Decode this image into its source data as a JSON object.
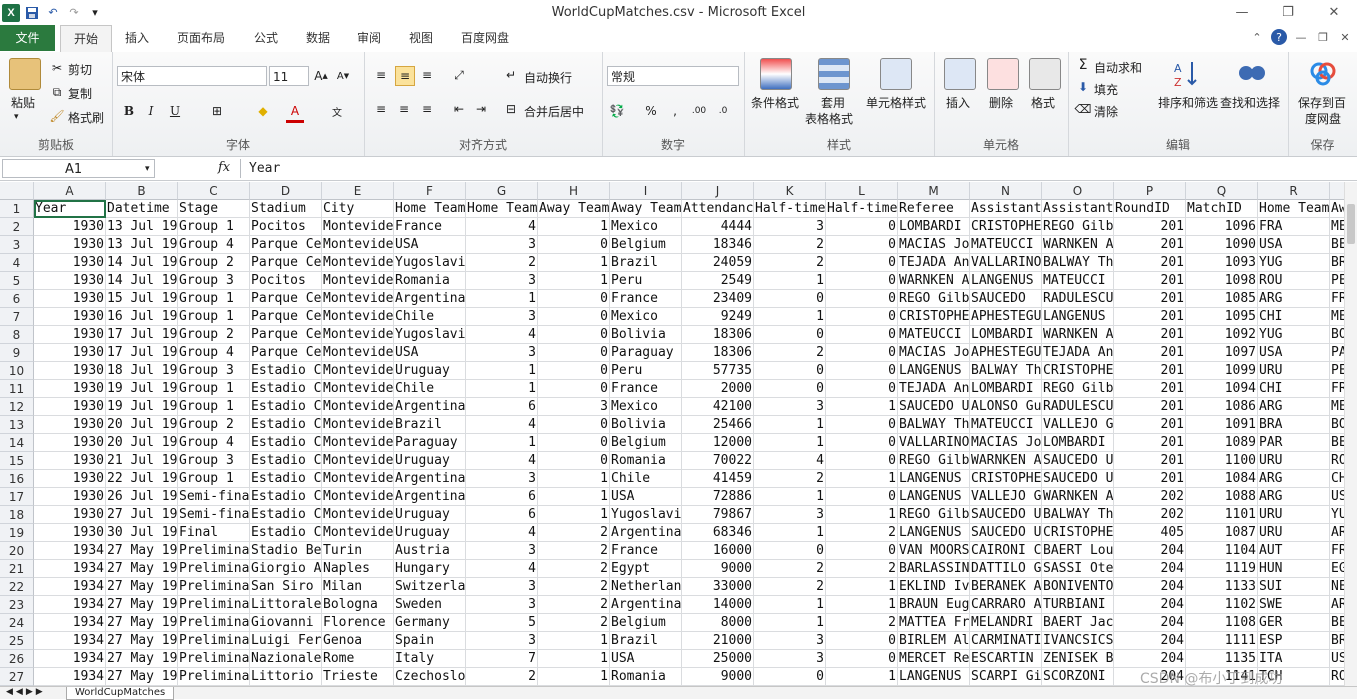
{
  "window": {
    "title": "WorldCupMatches.csv - Microsoft Excel"
  },
  "tabs": [
    {
      "label": "文件"
    },
    {
      "label": "开始"
    },
    {
      "label": "插入"
    },
    {
      "label": "页面布局"
    },
    {
      "label": "公式"
    },
    {
      "label": "数据"
    },
    {
      "label": "审阅"
    },
    {
      "label": "视图"
    },
    {
      "label": "百度网盘"
    }
  ],
  "ribbon": {
    "clipboard": {
      "label": "剪贴板",
      "paste": "粘贴",
      "cut": "剪切",
      "copy": "复制",
      "format_painter": "格式刷"
    },
    "font": {
      "label": "字体",
      "name": "宋体",
      "size": "11"
    },
    "alignment": {
      "label": "对齐方式",
      "wrap": "自动换行",
      "merge": "合并后居中"
    },
    "number": {
      "label": "数字",
      "format": "常规"
    },
    "styles": {
      "label": "样式",
      "cond": "条件格式",
      "table1": "套用",
      "table2": "表格格式",
      "cell_styles": "单元格样式"
    },
    "cells": {
      "label": "单元格",
      "insert": "插入",
      "delete": "删除",
      "format": "格式"
    },
    "editing": {
      "label": "编辑",
      "autosum": "自动求和",
      "fill": "填充",
      "clear": "清除",
      "sort": "排序和筛选",
      "find": "查找和选择"
    },
    "save": {
      "label": "保存",
      "line1": "保存到百",
      "line2": "度网盘"
    }
  },
  "formula_bar": {
    "namebox": "A1",
    "fx": "fx",
    "content": "Year"
  },
  "columns": [
    "A",
    "B",
    "C",
    "D",
    "E",
    "F",
    "G",
    "H",
    "I",
    "J",
    "K",
    "L",
    "M",
    "N",
    "O",
    "P",
    "Q",
    "R",
    "S"
  ],
  "rows": [
    [
      "Year",
      "Datetime",
      "Stage",
      "Stadium",
      "City",
      "Home Team",
      "Home Team",
      "Away Team",
      "Away Team",
      "Attendance",
      "Half-time",
      "Half-time",
      "Referee",
      "Assistant",
      "Assistant",
      "RoundID",
      "MatchID",
      "Home Team",
      "Aw"
    ],
    [
      "1930",
      "13 Jul 19",
      "Group 1",
      "Pocitos",
      "Montevideo",
      "France",
      "4",
      "1",
      "Mexico",
      "4444",
      "3",
      "0",
      "LOMBARDI",
      "CRISTOPHE",
      "REGO Gilb",
      "201",
      "1096",
      "FRA",
      "ME"
    ],
    [
      "1930",
      "13 Jul 19",
      "Group 4",
      "Parque Ce",
      "Montevideo",
      "USA",
      "3",
      "0",
      "Belgium",
      "18346",
      "2",
      "0",
      "MACIAS Jo",
      "MATEUCCI",
      "WARNKEN A",
      "201",
      "1090",
      "USA",
      "BE"
    ],
    [
      "1930",
      "14 Jul 19",
      "Group 2",
      "Parque Ce",
      "Montevideo",
      "Yugoslavia",
      "2",
      "1",
      "Brazil",
      "24059",
      "2",
      "0",
      "TEJADA An",
      "VALLARINO",
      "BALWAY Th",
      "201",
      "1093",
      "YUG",
      "BR"
    ],
    [
      "1930",
      "14 Jul 19",
      "Group 3",
      "Pocitos",
      "Montevideo",
      "Romania",
      "3",
      "1",
      "Peru",
      "2549",
      "1",
      "0",
      "WARNKEN A",
      "LANGENUS",
      "MATEUCCI",
      "201",
      "1098",
      "ROU",
      "PE"
    ],
    [
      "1930",
      "15 Jul 19",
      "Group 1",
      "Parque Ce",
      "Montevideo",
      "Argentina",
      "1",
      "0",
      "France",
      "23409",
      "0",
      "0",
      "REGO Gilb",
      "SAUCEDO",
      "RADULESCU",
      "201",
      "1085",
      "ARG",
      "FR"
    ],
    [
      "1930",
      "16 Jul 19",
      "Group 1",
      "Parque Ce",
      "Montevideo",
      "Chile",
      "3",
      "0",
      "Mexico",
      "9249",
      "1",
      "0",
      "CRISTOPHE",
      "APHESTEGU",
      "LANGENUS",
      "201",
      "1095",
      "CHI",
      "ME"
    ],
    [
      "1930",
      "17 Jul 19",
      "Group 2",
      "Parque Ce",
      "Montevideo",
      "Yugoslavia",
      "4",
      "0",
      "Bolivia",
      "18306",
      "0",
      "0",
      "MATEUCCI",
      "LOMBARDI",
      "WARNKEN A",
      "201",
      "1092",
      "YUG",
      "BO"
    ],
    [
      "1930",
      "17 Jul 19",
      "Group 4",
      "Parque Ce",
      "Montevideo",
      "USA",
      "3",
      "0",
      "Paraguay",
      "18306",
      "2",
      "0",
      "MACIAS Jo",
      "APHESTEGU",
      "TEJADA An",
      "201",
      "1097",
      "USA",
      "PA"
    ],
    [
      "1930",
      "18 Jul 19",
      "Group 3",
      "Estadio C",
      "Montevideo",
      "Uruguay",
      "1",
      "0",
      "Peru",
      "57735",
      "0",
      "0",
      "LANGENUS",
      "BALWAY Th",
      "CRISTOPHE",
      "201",
      "1099",
      "URU",
      "PE"
    ],
    [
      "1930",
      "19 Jul 19",
      "Group 1",
      "Estadio C",
      "Montevideo",
      "Chile",
      "1",
      "0",
      "France",
      "2000",
      "0",
      "0",
      "TEJADA An",
      "LOMBARDI",
      "REGO Gilb",
      "201",
      "1094",
      "CHI",
      "FR"
    ],
    [
      "1930",
      "19 Jul 19",
      "Group 1",
      "Estadio C",
      "Montevideo",
      "Argentina",
      "6",
      "3",
      "Mexico",
      "42100",
      "3",
      "1",
      "SAUCEDO U",
      "ALONSO Gu",
      "RADULESCU",
      "201",
      "1086",
      "ARG",
      "ME"
    ],
    [
      "1930",
      "20 Jul 19",
      "Group 2",
      "Estadio C",
      "Montevideo",
      "Brazil",
      "4",
      "0",
      "Bolivia",
      "25466",
      "1",
      "0",
      "BALWAY Th",
      "MATEUCCI",
      "VALLEJO G",
      "201",
      "1091",
      "BRA",
      "BO"
    ],
    [
      "1930",
      "20 Jul 19",
      "Group 4",
      "Estadio C",
      "Montevideo",
      "Paraguay",
      "1",
      "0",
      "Belgium",
      "12000",
      "1",
      "0",
      "VALLARINO",
      "MACIAS Jo",
      "LOMBARDI",
      "201",
      "1089",
      "PAR",
      "BE"
    ],
    [
      "1930",
      "21 Jul 19",
      "Group 3",
      "Estadio C",
      "Montevideo",
      "Uruguay",
      "4",
      "0",
      "Romania",
      "70022",
      "4",
      "0",
      "REGO Gilb",
      "WARNKEN A",
      "SAUCEDO U",
      "201",
      "1100",
      "URU",
      "RO"
    ],
    [
      "1930",
      "22 Jul 19",
      "Group 1",
      "Estadio C",
      "Montevideo",
      "Argentina",
      "3",
      "1",
      "Chile",
      "41459",
      "2",
      "1",
      "LANGENUS",
      "CRISTOPHE",
      "SAUCEDO U",
      "201",
      "1084",
      "ARG",
      "CH"
    ],
    [
      "1930",
      "26 Jul 19",
      "Semi-fina",
      "Estadio C",
      "Montevideo",
      "Argentina",
      "6",
      "1",
      "USA",
      "72886",
      "1",
      "0",
      "LANGENUS",
      "VALLEJO G",
      "WARNKEN A",
      "202",
      "1088",
      "ARG",
      "US"
    ],
    [
      "1930",
      "27 Jul 19",
      "Semi-fina",
      "Estadio C",
      "Montevideo",
      "Uruguay",
      "6",
      "1",
      "Yugoslavia",
      "79867",
      "3",
      "1",
      "REGO Gilb",
      "SAUCEDO U",
      "BALWAY Th",
      "202",
      "1101",
      "URU",
      "YU"
    ],
    [
      "1930",
      "30 Jul 19",
      "Final",
      "Estadio C",
      "Montevideo",
      "Uruguay",
      "4",
      "2",
      "Argentina",
      "68346",
      "1",
      "2",
      "LANGENUS",
      "SAUCEDO U",
      "CRISTOPHE",
      "405",
      "1087",
      "URU",
      "AR"
    ],
    [
      "1934",
      "27 May 19",
      "Prelimina",
      "Stadio Be",
      "Turin",
      "Austria",
      "3",
      "2",
      "France",
      "16000",
      "0",
      "0",
      "VAN MOORS",
      "CAIRONI C",
      "BAERT Lou",
      "204",
      "1104",
      "AUT",
      "FR"
    ],
    [
      "1934",
      "27 May 19",
      "Prelimina",
      "Giorgio A",
      "Naples",
      "Hungary",
      "4",
      "2",
      "Egypt",
      "9000",
      "2",
      "2",
      "BARLASSIN",
      "DATTILO G",
      "SASSI Ote",
      "204",
      "1119",
      "HUN",
      "EG"
    ],
    [
      "1934",
      "27 May 19",
      "Prelimina",
      "San Siro",
      "Milan",
      "Switzerland",
      "3",
      "2",
      "Netherlands",
      "33000",
      "2",
      "1",
      "EKLIND Iv",
      "BERANEK A",
      "BONIVENTO",
      "204",
      "1133",
      "SUI",
      "NE"
    ],
    [
      "1934",
      "27 May 19",
      "Prelimina",
      "Littorale",
      "Bologna",
      "Sweden",
      "3",
      "2",
      "Argentina",
      "14000",
      "1",
      "1",
      "BRAUN Eug",
      "CARRARO A",
      "TURBIANI",
      "204",
      "1102",
      "SWE",
      "AR"
    ],
    [
      "1934",
      "27 May 19",
      "Prelimina",
      "Giovanni",
      "Florence",
      "Germany",
      "5",
      "2",
      "Belgium",
      "8000",
      "1",
      "2",
      "MATTEA Fr",
      "MELANDRI",
      "BAERT Jac",
      "204",
      "1108",
      "GER",
      "BE"
    ],
    [
      "1934",
      "27 May 19",
      "Prelimina",
      "Luigi Fer",
      "Genoa",
      "Spain",
      "3",
      "1",
      "Brazil",
      "21000",
      "3",
      "0",
      "BIRLEM Al",
      "CARMINATI",
      "IVANCSICS",
      "204",
      "1111",
      "ESP",
      "BR"
    ],
    [
      "1934",
      "27 May 19",
      "Prelimina",
      "Nazionale",
      "Rome",
      "Italy",
      "7",
      "1",
      "USA",
      "25000",
      "3",
      "0",
      "MERCET Re",
      "ESCARTIN",
      "ZENISEK B",
      "204",
      "1135",
      "ITA",
      "US"
    ],
    [
      "1934",
      "27 May 19",
      "Prelimina",
      "Littorio",
      "Trieste",
      "Czechoslo",
      "2",
      "1",
      "Romania",
      "9000",
      "0",
      "1",
      "LANGENUS",
      "SCARPI Gi",
      "SCORZONI",
      "204",
      "1141",
      "TCH",
      "RO"
    ]
  ],
  "sheet_tab": "WorldCupMatches",
  "watermark": "CSDN @布小丁到成功"
}
